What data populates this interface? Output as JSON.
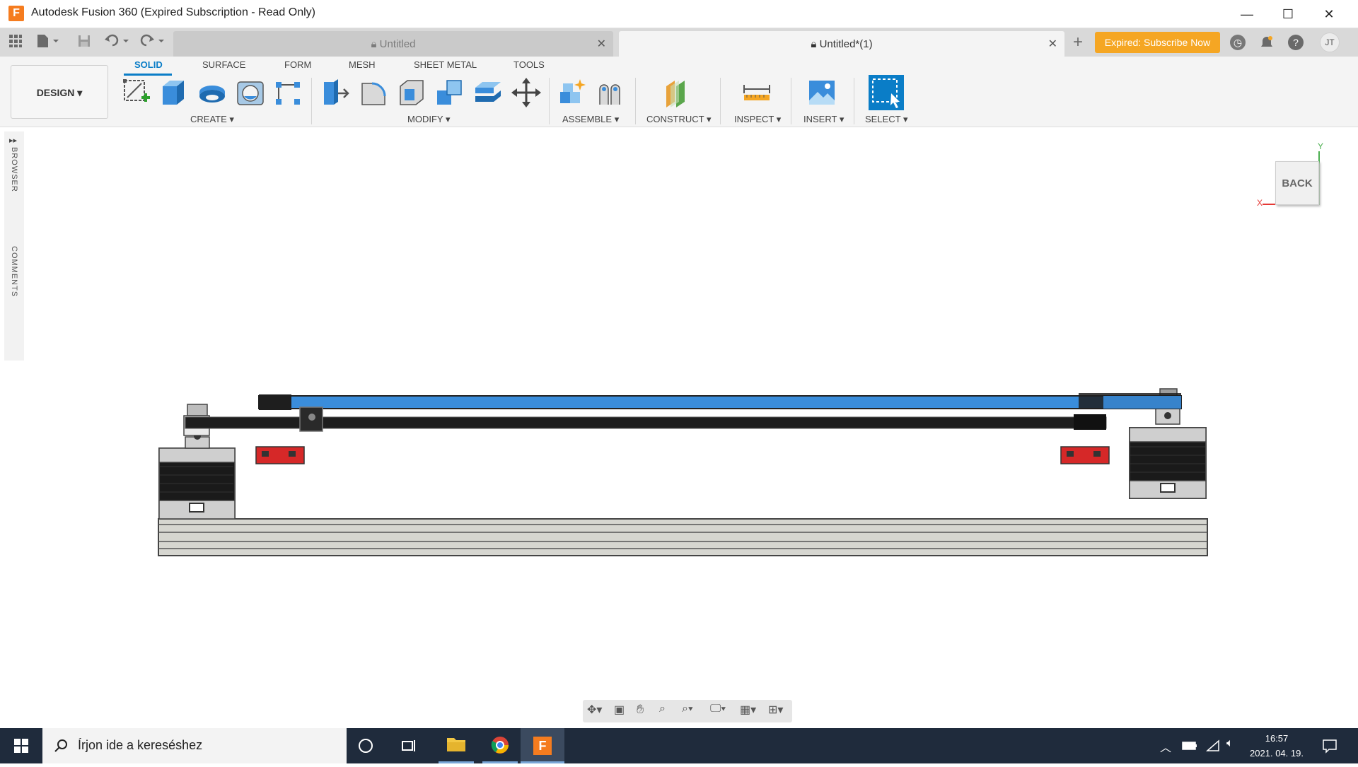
{
  "window": {
    "app_icon_letter": "F",
    "title": "Autodesk Fusion 360 (Expired Subscription - Read Only)",
    "minimize": "—",
    "maximize": "☐",
    "close": "✕"
  },
  "tabbar": {
    "tabs": [
      {
        "label": "Untitled",
        "active": false
      },
      {
        "label": "Untitled*(1)",
        "active": true
      }
    ],
    "subscribe_label": "Expired: Subscribe Now",
    "user_initials": "JT"
  },
  "toolbar": {
    "workspace": "DESIGN",
    "tabs": [
      "SOLID",
      "SURFACE",
      "FORM",
      "MESH",
      "SHEET METAL",
      "TOOLS"
    ],
    "groups": {
      "create": "CREATE",
      "modify": "MODIFY",
      "assemble": "ASSEMBLE",
      "construct": "CONSTRUCT",
      "inspect": "INSPECT",
      "insert": "INSERT",
      "select": "SELECT"
    }
  },
  "side_panel": {
    "browser": "BROWSER",
    "comments": "COMMENTS"
  },
  "viewcube": {
    "face": "BACK",
    "axis_y": "Y",
    "axis_x": "X"
  },
  "taskbar": {
    "search_placeholder": "Írjon ide a kereséshez",
    "time": "16:57",
    "date": "2021. 04. 19."
  },
  "colors": {
    "accent": "#0a7dc7",
    "subscribe": "#f5a623",
    "blue_rail": "#3a8ddb",
    "red_block": "#d62828"
  }
}
